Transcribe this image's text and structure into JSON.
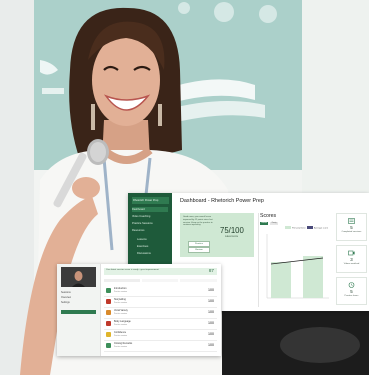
{
  "dashboard": {
    "title": "Dashboard - Rhetorich Power Prep",
    "brand": "Rhetorich Power Prep",
    "nav": [
      {
        "label": "Dashboard",
        "active": true
      },
      {
        "label": "Video Coaching",
        "active": false
      },
      {
        "label": "Practice Sessions",
        "active": false
      },
      {
        "label": "Resources",
        "active": false
      },
      {
        "label": "Lessons",
        "active": false
      },
      {
        "label": "Exercises",
        "active": false
      },
      {
        "label": "Discussions",
        "active": false
      }
    ],
    "score_card": {
      "blurb": "Good news, your overall score improved by 12 points since last session. Keep up the practice to continue improving.",
      "score": "75/100",
      "score_caption": "Latest score",
      "buttons": [
        "Practice",
        "Review"
      ]
    },
    "scores_panel": {
      "heading": "Scores",
      "chips": [
        "Overall",
        "Clarity"
      ],
      "legend": [
        "Personal best",
        "Average score"
      ]
    },
    "kpis": [
      {
        "value": "5",
        "label": "Completed sessions"
      },
      {
        "value": "3",
        "label": "Videos watched"
      },
      {
        "value": "5",
        "label": "Practice hours"
      }
    ]
  },
  "session_list": {
    "sidebar_items": [
      "Sessions",
      "Overview",
      "Settings"
    ],
    "header_text": "Your latest session score is ready - great improvement",
    "header_number": "87",
    "rows": [
      {
        "name": "Introduction",
        "sub": "Practice session",
        "score": "100",
        "color": "#3d8f5a"
      },
      {
        "name": "Storytelling",
        "sub": "Practice session",
        "score": "100",
        "color": "#c0392b"
      },
      {
        "name": "Vocal Variety",
        "sub": "Practice session",
        "score": "100",
        "color": "#d98a2b"
      },
      {
        "name": "Body Language",
        "sub": "Practice session",
        "score": "100",
        "color": "#c0392b"
      },
      {
        "name": "Confidence",
        "sub": "Practice session",
        "score": "100",
        "color": "#e0b52b"
      },
      {
        "name": "Closing Remarks",
        "sub": "Practice session",
        "score": "100",
        "color": "#3d8f5a"
      }
    ]
  },
  "colors": {
    "brand_green": "#1e5a3a",
    "accent_green": "#2f7a50",
    "card_green": "#cfe8d3"
  }
}
